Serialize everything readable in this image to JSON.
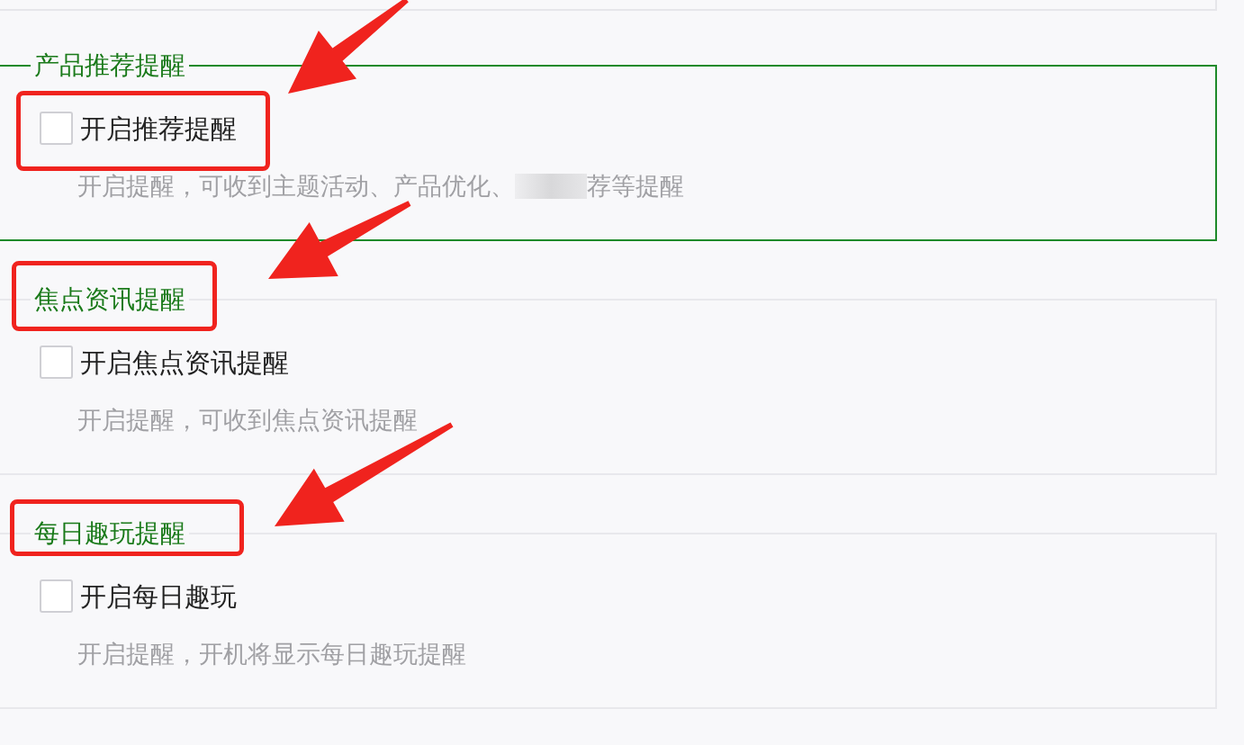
{
  "sections": [
    {
      "title": "产品推荐提醒",
      "highlighted": true,
      "checkbox": {
        "label": "开启推荐提醒",
        "checked": false
      },
      "description": "开启提醒，可收到主题活动、产品优化、",
      "redacted": true,
      "description_after": "荐等提醒"
    },
    {
      "title": "焦点资讯提醒",
      "highlighted": false,
      "checkbox": {
        "label": "开启焦点资讯提醒",
        "checked": false
      },
      "description": "开启提醒，可收到焦点资讯提醒"
    },
    {
      "title": "每日趣玩提醒",
      "highlighted": false,
      "checkbox": {
        "label": "开启每日趣玩",
        "checked": false
      },
      "description": "开启提醒，开机将显示每日趣玩提醒"
    }
  ]
}
